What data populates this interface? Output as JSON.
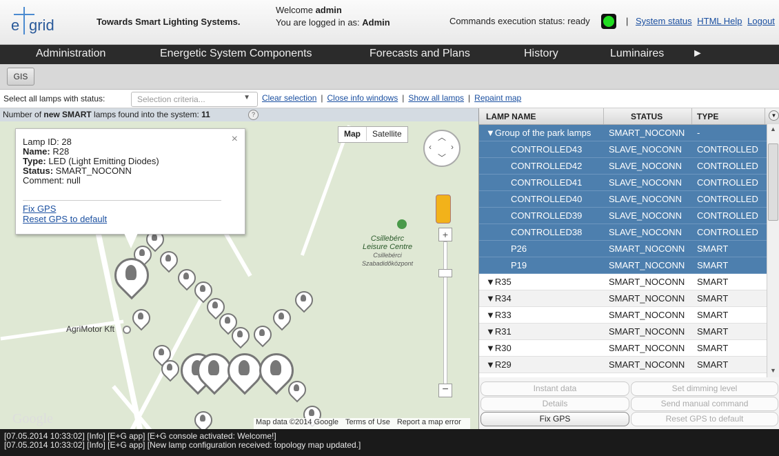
{
  "header": {
    "logo_e": "e",
    "logo_grid": "grid",
    "tagline": "Towards Smart Lighting Systems.",
    "welcome_prefix": "Welcome ",
    "welcome_user": "admin",
    "logged_prefix": "You are logged in as: ",
    "logged_user": "Admin",
    "cmd_status": "Commands execution status: ready",
    "separator": "|",
    "links": [
      "System status",
      "HTML Help",
      "Logout"
    ],
    "status_color": "#22dd22"
  },
  "nav": {
    "items": [
      "Administration",
      "Energetic System Components",
      "Forecasts and Plans",
      "History",
      "Luminaires",
      "►"
    ]
  },
  "tabs": {
    "gis": "GIS"
  },
  "toolbar": {
    "select_label": "Select all lamps with status:",
    "select_placeholder": "Selection criteria...",
    "select_arrow": "▼",
    "links": [
      "Clear selection",
      "Close info windows",
      "Show all lamps",
      "Repaint map"
    ],
    "sep": "|"
  },
  "countbar": {
    "prefix": "Number of ",
    "new_word": "new",
    "smart_word": "SMART",
    "suffix": " lamps found into the system: ",
    "count": "11",
    "help": "?"
  },
  "map": {
    "type_map": "Map",
    "type_satellite": "Satellite",
    "park_name_1": "Csillebérc",
    "park_name_2": "Leisure Centre",
    "park_sub_1": "Csillebérci",
    "park_sub_2": "Szabadidőközpont",
    "business": "AgriMotor Kft",
    "logo": "Google",
    "attribution": [
      "Map data ©2014 Google",
      "Terms of Use",
      "Report a map error"
    ],
    "zoom_in": "+",
    "zoom_out": "−"
  },
  "info_window": {
    "close": "×",
    "lamp_id_label": "Lamp ID: ",
    "lamp_id": "28",
    "name_label": "Name: ",
    "name": "R28",
    "type_label": "Type: ",
    "type": "LED (Light Emitting Diodes)",
    "status_label": "Status: ",
    "status": "SMART_NOCONN",
    "comment_label": "Comment: ",
    "comment": "null",
    "fix_gps": "Fix GPS",
    "reset_gps": "Reset GPS to default"
  },
  "grid": {
    "columns": [
      "LAMP NAME",
      "STATUS",
      "TYPE"
    ],
    "rows": [
      {
        "name": "▼Group of the park lamps",
        "status": "SMART_NOCONN",
        "type": "-"
      },
      {
        "name": "CONTROLLED43",
        "status": "SLAVE_NOCONN",
        "type": "CONTROLLED"
      },
      {
        "name": "CONTROLLED42",
        "status": "SLAVE_NOCONN",
        "type": "CONTROLLED"
      },
      {
        "name": "CONTROLLED41",
        "status": "SLAVE_NOCONN",
        "type": "CONTROLLED"
      },
      {
        "name": "CONTROLLED40",
        "status": "SLAVE_NOCONN",
        "type": "CONTROLLED"
      },
      {
        "name": "CONTROLLED39",
        "status": "SLAVE_NOCONN",
        "type": "CONTROLLED"
      },
      {
        "name": "CONTROLLED38",
        "status": "SLAVE_NOCONN",
        "type": "CONTROLLED"
      },
      {
        "name": "P26",
        "status": "SMART_NOCONN",
        "type": "SMART"
      },
      {
        "name": "P19",
        "status": "SMART_NOCONN",
        "type": "SMART"
      },
      {
        "name": "▼R35",
        "status": "SMART_NOCONN",
        "type": "SMART"
      },
      {
        "name": "▼R34",
        "status": "SMART_NOCONN",
        "type": "SMART"
      },
      {
        "name": "▼R33",
        "status": "SMART_NOCONN",
        "type": "SMART"
      },
      {
        "name": "▼R31",
        "status": "SMART_NOCONN",
        "type": "SMART"
      },
      {
        "name": "▼R30",
        "status": "SMART_NOCONN",
        "type": "SMART"
      },
      {
        "name": "▼R29",
        "status": "SMART_NOCONN",
        "type": "SMART"
      }
    ]
  },
  "actions": {
    "instant_data": "Instant data",
    "set_dimming": "Set dimming level",
    "details": "Details",
    "send_manual": "Send manual command",
    "fix_gps": "Fix GPS",
    "reset_gps": "Reset GPS to default"
  },
  "console": {
    "lines": [
      "[07.05.2014 10:33:02] [Info] [E+G app] [E+G console activated: Welcome!]",
      "[07.05.2014 10:33:02] [Info] [E+G app] [New lamp configuration received: topology map updated.]"
    ]
  }
}
